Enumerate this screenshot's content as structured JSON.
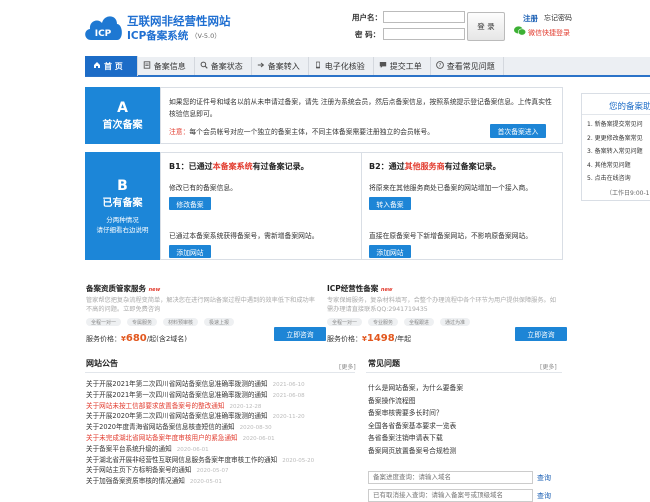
{
  "brand": {
    "line1": "互联网非经营性网站",
    "line2": "ICP备案系统",
    "version": "（V-5.0）",
    "logo_text": "ICP"
  },
  "login": {
    "username_label": "用户名：",
    "password_label": "密  码：",
    "username_value": "",
    "password_value": "",
    "login_button": "登 录",
    "register": "注册",
    "forgot_password": "忘记密码",
    "wechat_login": "微信快捷登录"
  },
  "nav": {
    "items": [
      {
        "label": "首 页",
        "icon": "home-icon",
        "active": true
      },
      {
        "label": "备案信息",
        "icon": "doc-icon",
        "active": false
      },
      {
        "label": "备案状态",
        "icon": "search-icon",
        "active": false
      },
      {
        "label": "备案转入",
        "icon": "transfer-icon",
        "active": false
      },
      {
        "label": "电子化核验",
        "icon": "phone-icon",
        "active": false
      },
      {
        "label": "提交工单",
        "icon": "chat-icon",
        "active": false
      },
      {
        "label": "查看常见问题",
        "icon": "help-icon",
        "active": false
      }
    ]
  },
  "block_a": {
    "letter": "A",
    "title": "首次备案",
    "text": "如果您的证件号和域名以前从未申请过备案，请先 注册为系统会员，然后点备案信息，按照系统提示登记备案信息。上传真实性核验信息即可。",
    "note_label": "注意：",
    "note_text": "每个会员帐号对应一个独立的备案主体，不同主体备案需要注册独立的会员帐号。",
    "button": "首次备案进入"
  },
  "block_b": {
    "letter": "B",
    "title": "已有备案",
    "sub1": "分两种情况",
    "sub2": "请仔细看右边说明",
    "b1": {
      "prefix": "B1：已通过",
      "highlight": "本备案系统",
      "suffix": "有过备案记录。",
      "text1": "修改已有的备案信息。",
      "btn1": "修改备案",
      "text2": "已通过本备案系统获得备案号，需新增备案网站。",
      "btn2": "添加网站"
    },
    "b2": {
      "prefix": "B2：通过",
      "highlight": "其他服务商",
      "suffix": "有过备案记录。",
      "text1": "将原来在其他服务商处已备案的网站增加一个接入商。",
      "btn1": "转入备案",
      "text2": "直接在原备案号下新增备案网站，不影响原备案网站。",
      "btn2": "添加网站"
    }
  },
  "sidebar": {
    "title": "您的备案助",
    "items": [
      "1. 新备案提交常见问",
      "2. 更更修改备案常见",
      "3. 备案转入常见问题",
      "4. 其他常见问题",
      "5. 点击在线咨询"
    ],
    "hours": "（工作日9:00-1"
  },
  "services": [
    {
      "title": "备案资质管家服务",
      "new": "new",
      "desc": "管家帮您把复杂流程变简单，解决您在进行网站备案过程中遇到的效率低下和成功率不高的问题。立即免费咨询",
      "tags": [
        "全程一对一",
        "专属服务",
        "材料预审核",
        "极速上报"
      ],
      "price_label": "服务价格：",
      "price_currency": "¥",
      "price": "680",
      "price_unit": "/起(含2域名)",
      "button": "立即咨询"
    },
    {
      "title": "ICP经营性备案",
      "new": "new",
      "desc": "专家保姆服务，复杂材料填写，合整个办理流程中各个环节为用户提供保障服务。如需办理请直接联系QQ:2941719435",
      "tags": [
        "全程一对一",
        "专业服务",
        "全程跟进",
        "通过为准"
      ],
      "price_label": "服务价格：",
      "price_currency": "¥",
      "price": "1498",
      "price_unit": "/年起",
      "button": "立即咨询"
    }
  ],
  "notices": {
    "title": "网站公告",
    "more": "[更多]",
    "items": [
      {
        "title": "关于开展2021年第二次四川省网站备案信息准确率拨测的通知",
        "date": "2021-06-10",
        "hl": false
      },
      {
        "title": "关于开展2021年第一次四川省网站备案信息准确率拨测的通知",
        "date": "2021-06-08",
        "hl": false
      },
      {
        "title": "关于网站未按工信部要求放置备案号的整改通知",
        "date": "2020-12-28",
        "hl": true
      },
      {
        "title": "关于开展2020年第二次四川省网站备案信息准确率拨测的通知",
        "date": "2020-11-20",
        "hl": false
      },
      {
        "title": "关于2020年度青海省网站备案信息核查短信的通知",
        "date": "2020-08-30",
        "hl": false
      },
      {
        "title": "关于未完成湖北省网站备案年度审核用户的紧急通知",
        "date": "2020-06-01",
        "hl": true
      },
      {
        "title": "关于备案平台系统升级的通知",
        "date": "2020-06-01",
        "hl": false
      },
      {
        "title": "关于湖北省开展非经营性互联网信息服务备案年度审核工作的通知",
        "date": "2020-05-20",
        "hl": false
      },
      {
        "title": "关于网站主页下方标明备案号的通知",
        "date": "2020-05-07",
        "hl": false
      },
      {
        "title": "关于加强备案资质审核的情况通知",
        "date": "2020-05-01",
        "hl": false
      }
    ]
  },
  "faq": {
    "title": "常见问题",
    "more": "[更多]",
    "items": [
      "什么是网站备案，为什么要备案",
      "备案操作流程图",
      "备案审核需要多长时间？",
      "全国各省备案基本要求一览表",
      "各省备案注销申请表下载",
      "备案网页放置备案号合规检测"
    ],
    "query1_placeholder": "备案进度查询：请输入域名",
    "query1_button": "查询",
    "query2_placeholder": "已有取消接入查询：请输入备案号或顶级域名",
    "query2_button": "查询"
  },
  "colors": {
    "primary": "#1c86d8",
    "nav_active": "#1c6cc7",
    "highlight_red": "#e23b2e",
    "price_orange": "#e2571e"
  }
}
